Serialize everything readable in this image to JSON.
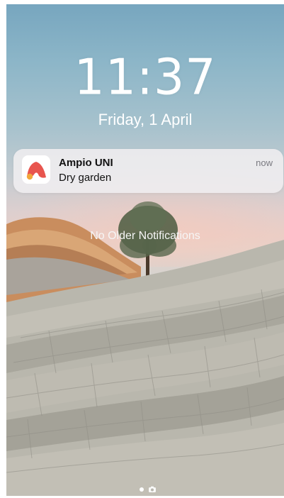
{
  "lock_screen": {
    "time": "11:37",
    "date": "Friday, 1 April",
    "empty_state": "No Older Notifications"
  },
  "notification": {
    "app_name": "Ampio UNI",
    "message": "Dry garden",
    "time": "now",
    "icon": "ampio-app-icon",
    "accent_color": "#e8554e",
    "accent_secondary": "#f2a73b"
  },
  "page_indicator": {
    "icons": [
      "page-dot-icon",
      "camera-icon"
    ]
  }
}
